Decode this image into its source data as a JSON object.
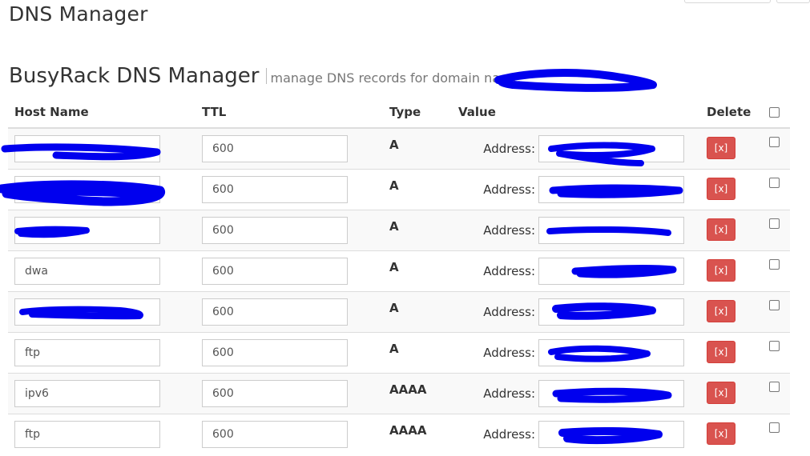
{
  "page_title": "DNS Manager",
  "section": {
    "title": "BusyRack DNS Manager",
    "subtitle": "manage DNS records for domain name"
  },
  "table": {
    "headers": {
      "host": "Host Name",
      "ttl": "TTL",
      "type": "Type",
      "value": "Value",
      "delete": "Delete"
    },
    "address_label": "Address:",
    "delete_label": "[x]",
    "rows": [
      {
        "host": "",
        "ttl": "600",
        "type": "A",
        "value": ""
      },
      {
        "host": "",
        "ttl": "600",
        "type": "A",
        "value": ""
      },
      {
        "host": "",
        "ttl": "600",
        "type": "A",
        "value": ""
      },
      {
        "host": "dwa",
        "ttl": "600",
        "type": "A",
        "value": ""
      },
      {
        "host": "",
        "ttl": "600",
        "type": "A",
        "value": ""
      },
      {
        "host": "ftp",
        "ttl": "600",
        "type": "A",
        "value": ""
      },
      {
        "host": "ipv6",
        "ttl": "600",
        "type": "AAAA",
        "value": ""
      },
      {
        "host": "ftp",
        "ttl": "600",
        "type": "AAAA",
        "value": ""
      }
    ]
  },
  "colors": {
    "delete_button": "#d9534f",
    "redaction": "#0000ee"
  }
}
